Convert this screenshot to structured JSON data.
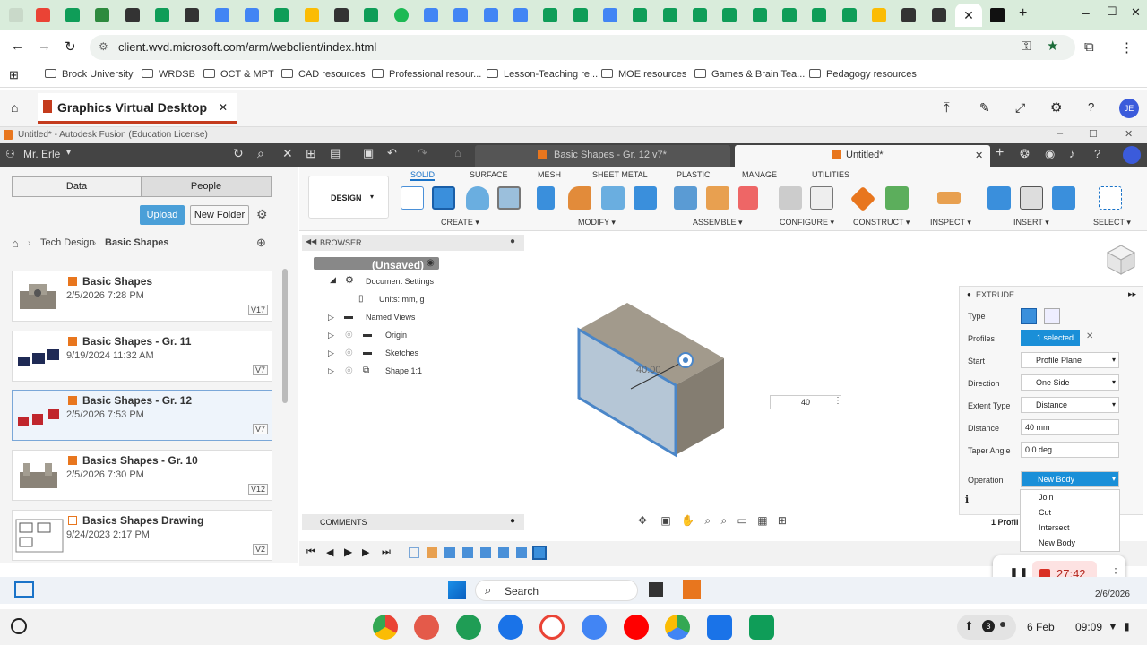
{
  "browser": {
    "url": "client.wvd.microsoft.com/arm/webclient/index.html",
    "bookmarks": [
      "Brock University",
      "WRDSB",
      "OCT & MPT",
      "CAD resources",
      "Professional resour...",
      "Lesson-Teaching re...",
      "MOE resources",
      "Games & Brain Tea...",
      "Pedagogy resources"
    ]
  },
  "wvd": {
    "tab_title": "Graphics Virtual Desktop",
    "avatar": "JE"
  },
  "fusion": {
    "window_title": "Untitled* - Autodesk Fusion (Education License)",
    "user": "Mr. Erle",
    "doc_tabs": [
      "Basic Shapes - Gr. 12 v7*",
      "Untitled*"
    ],
    "data_tabs": [
      "Data",
      "People"
    ],
    "upload_label": "Upload",
    "new_folder_label": "New Folder",
    "breadcrumb": [
      "Tech Design",
      "Basic Shapes"
    ],
    "files": [
      {
        "name": "Basic Shapes",
        "date": "2/5/2026 7:28 PM",
        "ver": "V17"
      },
      {
        "name": "Basic Shapes - Gr. 11",
        "date": "9/19/2024 11:32 AM",
        "ver": "V7"
      },
      {
        "name": "Basic Shapes - Gr. 12",
        "date": "2/5/2026 7:53 PM",
        "ver": "V7"
      },
      {
        "name": "Basics Shapes - Gr. 10",
        "date": "2/5/2026 7:30 PM",
        "ver": "V12"
      },
      {
        "name": "Basics Shapes Drawing",
        "date": "9/24/2023 2:17 PM",
        "ver": "V2"
      }
    ],
    "workspace": "DESIGN",
    "toolbar_tabs": [
      "SOLID",
      "SURFACE",
      "MESH",
      "SHEET METAL",
      "PLASTIC",
      "MANAGE",
      "UTILITIES"
    ],
    "groups": [
      "CREATE",
      "MODIFY",
      "ASSEMBLE",
      "CONFIGURE",
      "CONSTRUCT",
      "INSPECT",
      "INSERT",
      "SELECT"
    ],
    "browser_title": "BROWSER",
    "tree": [
      "(Unsaved)",
      "Document Settings",
      "Units: mm, g",
      "Named Views",
      "Origin",
      "Sketches",
      "Shape 1:1"
    ],
    "comments": "COMMENTS",
    "dim_value": "40",
    "dim_label": "40.00"
  },
  "extrude": {
    "title": "EXTRUDE",
    "rows": [
      {
        "label": "Type",
        "value": ""
      },
      {
        "label": "Profiles",
        "value": "1 selected"
      },
      {
        "label": "Start",
        "value": "Profile Plane"
      },
      {
        "label": "Direction",
        "value": "One Side"
      },
      {
        "label": "Extent Type",
        "value": "Distance"
      },
      {
        "label": "Distance",
        "value": "40 mm"
      },
      {
        "label": "Taper Angle",
        "value": "0.0 deg"
      },
      {
        "label": "Operation",
        "value": "New Body"
      }
    ],
    "menu": [
      "Join",
      "Cut",
      "Intersect",
      "New Body"
    ],
    "profile_count": "1 Profil"
  },
  "taskbar": {
    "search": "Search",
    "date_small": "2/6/2026"
  },
  "recorder": {
    "time": "27:42"
  },
  "shelf": {
    "date": "6 Feb",
    "time": "09:09",
    "badge": "3"
  }
}
